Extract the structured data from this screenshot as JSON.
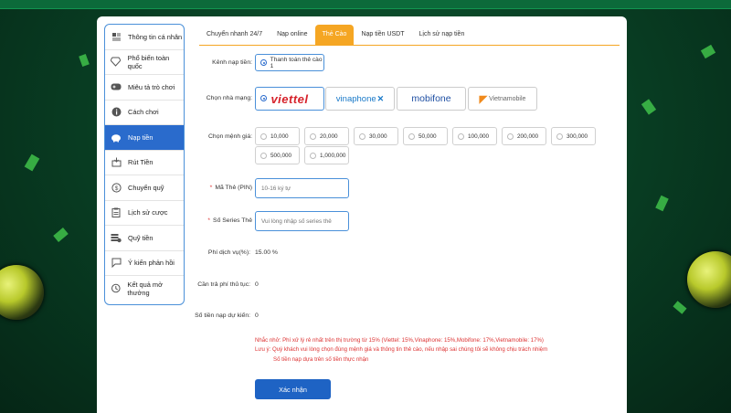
{
  "sidebar": {
    "items": [
      {
        "label": "Thông tin cá nhân",
        "icon": "profile-icon"
      },
      {
        "label": "Phổ biến toàn quốc",
        "icon": "diamond-icon"
      },
      {
        "label": "Miêu tả trò chơi",
        "icon": "gamepad-icon"
      },
      {
        "label": "Cách chơi",
        "icon": "info-icon"
      },
      {
        "label": "Nạp tiền",
        "icon": "piggy-bank-icon",
        "active": true
      },
      {
        "label": "Rút Tiền",
        "icon": "withdraw-icon"
      },
      {
        "label": "Chuyển quỹ",
        "icon": "coin-icon"
      },
      {
        "label": "Lịch sử cược",
        "icon": "clipboard-icon"
      },
      {
        "label": "Quỹ tiền",
        "icon": "money-stack-icon"
      },
      {
        "label": "Ý kiến phản hồi",
        "icon": "feedback-icon"
      },
      {
        "label": "Kết quả mở thưởng",
        "icon": "history-icon"
      }
    ]
  },
  "tabs": [
    {
      "label": "Chuyển nhanh 24/7"
    },
    {
      "label": "Nạp online"
    },
    {
      "label": "Thẻ Cào",
      "active": true
    },
    {
      "label": "Nạp tiền USDT"
    },
    {
      "label": "Lịch sử nạp tiền"
    }
  ],
  "form": {
    "channel_label": "Kênh nạp tiền:",
    "channel_value": "Thanh toán thẻ cào 1",
    "network_label": "Chọn nhà mạng:",
    "networks": [
      {
        "name": "viettel",
        "selected": true
      },
      {
        "name": "vinaphone"
      },
      {
        "name": "mobifone"
      },
      {
        "name": "Vietnamobile"
      }
    ],
    "amount_label": "Chọn mệnh giá:",
    "amounts": [
      "10,000",
      "20,000",
      "30,000",
      "50,000",
      "100,000",
      "200,000",
      "300,000",
      "500,000",
      "1,000,000"
    ],
    "pin_label": "Mã Thẻ (PIN)",
    "pin_placeholder": "10-16 ký tự",
    "serial_label": "Số Series Thẻ",
    "serial_placeholder": "Vui lòng nhập số series thẻ",
    "fee_label": "Phí dịch vụ(%):",
    "fee_value": "15.00 %",
    "need_fee_label": "Cần trả phí thủ tục:",
    "need_fee_value": "0",
    "expected_label": "Số tiền nạp dự kiến:",
    "expected_value": "0",
    "notes": [
      "Nhắc nhở: Phí xử lý rẻ nhất trên thị trường từ 15% (Viettel: 15%,Vinaphone: 15%,Mobifone: 17%,Vietnamobile: 17%)",
      "Lưu ý: Quý khách vui lòng chọn đúng mệnh giá và thông tin thẻ cào, nếu nhập sai chúng tôi sẽ không chịu trách nhiệm",
      "Số tiền nạp dựa trên số tiền thực nhận"
    ],
    "submit_label": "Xác nhận"
  },
  "colors": {
    "accent": "#f5a623",
    "primary": "#1e63c4",
    "background": "#0a4a2a",
    "danger": "#d33333"
  }
}
